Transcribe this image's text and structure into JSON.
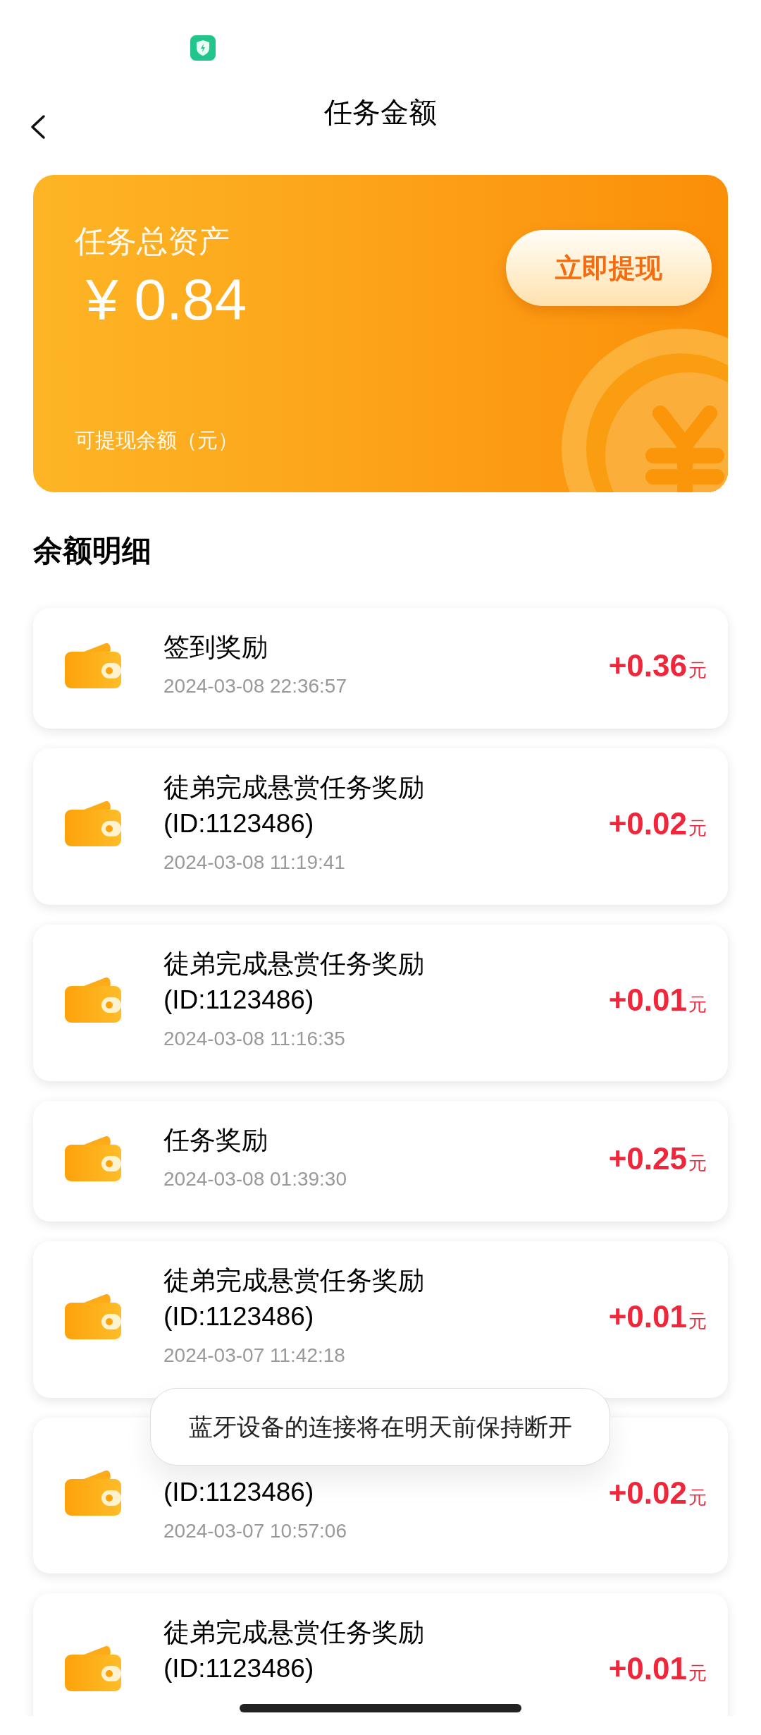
{
  "header": {
    "title": "任务金额"
  },
  "asset_card": {
    "title": "任务总资产",
    "amount": "¥ 0.84",
    "withdraw_button": "立即提现",
    "caption": "可提现余额（元）"
  },
  "section_title": "余额明细",
  "rows": [
    {
      "title_lines": [
        "签到奖励"
      ],
      "date": "2024-03-08 22:36:57",
      "amount": "+0.36",
      "unit": "元"
    },
    {
      "title_lines": [
        "徒弟完成悬赏任务奖励",
        "(ID:1123486)"
      ],
      "date": "2024-03-08 11:19:41",
      "amount": "+0.02",
      "unit": "元"
    },
    {
      "title_lines": [
        "徒弟完成悬赏任务奖励",
        "(ID:1123486)"
      ],
      "date": "2024-03-08 11:16:35",
      "amount": "+0.01",
      "unit": "元"
    },
    {
      "title_lines": [
        "任务奖励"
      ],
      "date": "2024-03-08 01:39:30",
      "amount": "+0.25",
      "unit": "元"
    },
    {
      "title_lines": [
        "徒弟完成悬赏任务奖励",
        "(ID:1123486)"
      ],
      "date": "2024-03-07 11:42:18",
      "amount": "+0.01",
      "unit": "元"
    },
    {
      "title_lines": [
        "(ID:1123486)"
      ],
      "top_covered": true,
      "date": "2024-03-07 10:57:06",
      "amount": "+0.02",
      "unit": "元"
    },
    {
      "title_lines": [
        "徒弟完成悬赏任务奖励",
        "(ID:1123486)"
      ],
      "amount": "+0.01",
      "unit": "元"
    }
  ],
  "toast": "蓝牙设备的连接将在明天前保持断开"
}
